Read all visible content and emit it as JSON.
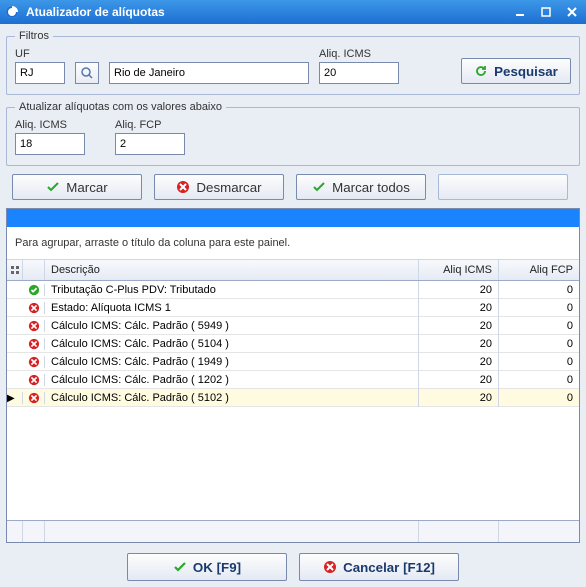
{
  "window": {
    "title": "Atualizador de alíquotas"
  },
  "filters": {
    "legend": "Filtros",
    "uf_label": "UF",
    "uf_value": "RJ",
    "uf_name": "Rio de Janeiro",
    "aliq_icms_label": "Aliq. ICMS",
    "aliq_icms_value": "20",
    "search_label": "Pesquisar"
  },
  "update": {
    "legend": "Atualizar alíquotas com os valores abaixo",
    "aliq_icms_label": "Aliq. ICMS",
    "aliq_icms_value": "18",
    "aliq_fcp_label": "Aliq. FCP",
    "aliq_fcp_value": "2"
  },
  "toolbar": {
    "marcar": "Marcar",
    "desmarcar": "Desmarcar",
    "marcar_todos": "Marcar todos"
  },
  "grid": {
    "group_hint": "Para agrupar, arraste o título da coluna para este painel.",
    "headers": {
      "descricao": "Descrição",
      "aliq_icms": "Aliq ICMS",
      "aliq_fcp": "Aliq FCP"
    },
    "rows": [
      {
        "status": "ok",
        "descricao": "Tributação C-Plus PDV: Tributado",
        "aliq_icms": "20",
        "aliq_fcp": "0",
        "selected": false
      },
      {
        "status": "error",
        "descricao": "Estado: Alíquota ICMS 1",
        "aliq_icms": "20",
        "aliq_fcp": "0",
        "selected": false
      },
      {
        "status": "error",
        "descricao": "Cálculo ICMS: Cálc. Padrão ( 5949 )",
        "aliq_icms": "20",
        "aliq_fcp": "0",
        "selected": false
      },
      {
        "status": "error",
        "descricao": "Cálculo ICMS: Cálc. Padrão ( 5104 )",
        "aliq_icms": "20",
        "aliq_fcp": "0",
        "selected": false
      },
      {
        "status": "error",
        "descricao": "Cálculo ICMS: Cálc. Padrão ( 1949 )",
        "aliq_icms": "20",
        "aliq_fcp": "0",
        "selected": false
      },
      {
        "status": "error",
        "descricao": "Cálculo ICMS: Cálc. Padrão ( 1202 )",
        "aliq_icms": "20",
        "aliq_fcp": "0",
        "selected": false
      },
      {
        "status": "error",
        "descricao": "Cálculo ICMS: Cálc. Padrão ( 5102 )",
        "aliq_icms": "20",
        "aliq_fcp": "0",
        "selected": true
      }
    ]
  },
  "buttons": {
    "ok": "OK [F9]",
    "cancel": "Cancelar [F12]"
  },
  "colors": {
    "title_gradient_top": "#3d97e8",
    "title_gradient_bottom": "#1c6fd1",
    "client_bg": "#e9edf4",
    "accent_blue": "#1a84ff",
    "ok_green": "#2aa82a",
    "error_red": "#d62222"
  }
}
